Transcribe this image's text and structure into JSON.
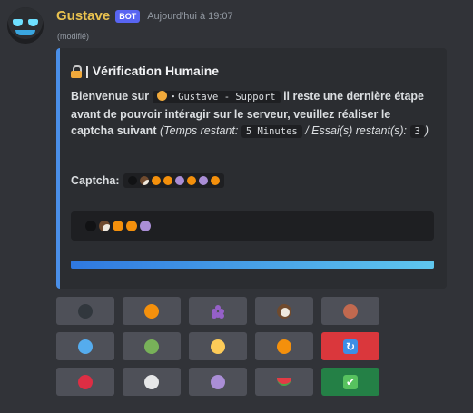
{
  "message": {
    "author": "Gustave",
    "bot_badge": "BOT",
    "timestamp": "Aujourd'hui à 19:07",
    "edited": "(modifié)"
  },
  "embed": {
    "title": "| Vérification Humaine",
    "accent_color": "#4a8fe8",
    "desc_intro": "Bienvenue sur ",
    "server_name": "・Gustave - Support",
    "desc_mid": " il reste une dernière étape avant de pouvoir intéragir sur le serveur, veuillez réaliser le captcha suivant ",
    "time_label": "(Temps restant: ",
    "time_value": "5 Minutes",
    "tries_label": " / Essai(s) restant(s): ",
    "tries_value": "3",
    "tries_close": ")",
    "captcha_label": "Captcha:",
    "captcha_sequence": [
      "black-circle",
      "coconut",
      "orange-circle",
      "tangerine",
      "purple-circle",
      "tangerine",
      "purple-circle",
      "tangerine"
    ],
    "entered_sequence": [
      "black-circle",
      "coconut",
      "orange-circle",
      "tangerine",
      "purple-circle"
    ]
  },
  "colors": {
    "black-circle": "#111214",
    "coconut": "#6f4a2e",
    "orange-circle": "#f4900c",
    "tangerine": "#f4900c",
    "purple-circle": "#aa8ed6"
  },
  "buttons": [
    {
      "icon": "black-circle",
      "color": "#31373d",
      "style": "secondary"
    },
    {
      "icon": "orange-circle",
      "color": "#f4900c",
      "style": "secondary"
    },
    {
      "icon": "grapes",
      "color": "#9560c8",
      "style": "secondary"
    },
    {
      "icon": "coconut",
      "color": "#6f4a2e",
      "style": "secondary"
    },
    {
      "icon": "brown-circle",
      "color": "#c1694f",
      "style": "secondary"
    },
    {
      "icon": "blue-circle",
      "color": "#55acee",
      "style": "secondary"
    },
    {
      "icon": "green-circle",
      "color": "#78b159",
      "style": "secondary"
    },
    {
      "icon": "yellow-circle",
      "color": "#fdcb58",
      "style": "secondary"
    },
    {
      "icon": "tangerine",
      "color": "#f4900c",
      "style": "secondary"
    },
    {
      "icon": "refresh",
      "color": "#3d8ee6",
      "style": "danger"
    },
    {
      "icon": "red-circle",
      "color": "#dd2e44",
      "style": "secondary"
    },
    {
      "icon": "white-circle",
      "color": "#e6e7e8",
      "style": "secondary"
    },
    {
      "icon": "purple-circle",
      "color": "#aa8ed6",
      "style": "secondary"
    },
    {
      "icon": "watermelon",
      "color": "#e23b45",
      "style": "secondary"
    },
    {
      "icon": "check-mark",
      "color": "#57c25f",
      "style": "success"
    }
  ]
}
